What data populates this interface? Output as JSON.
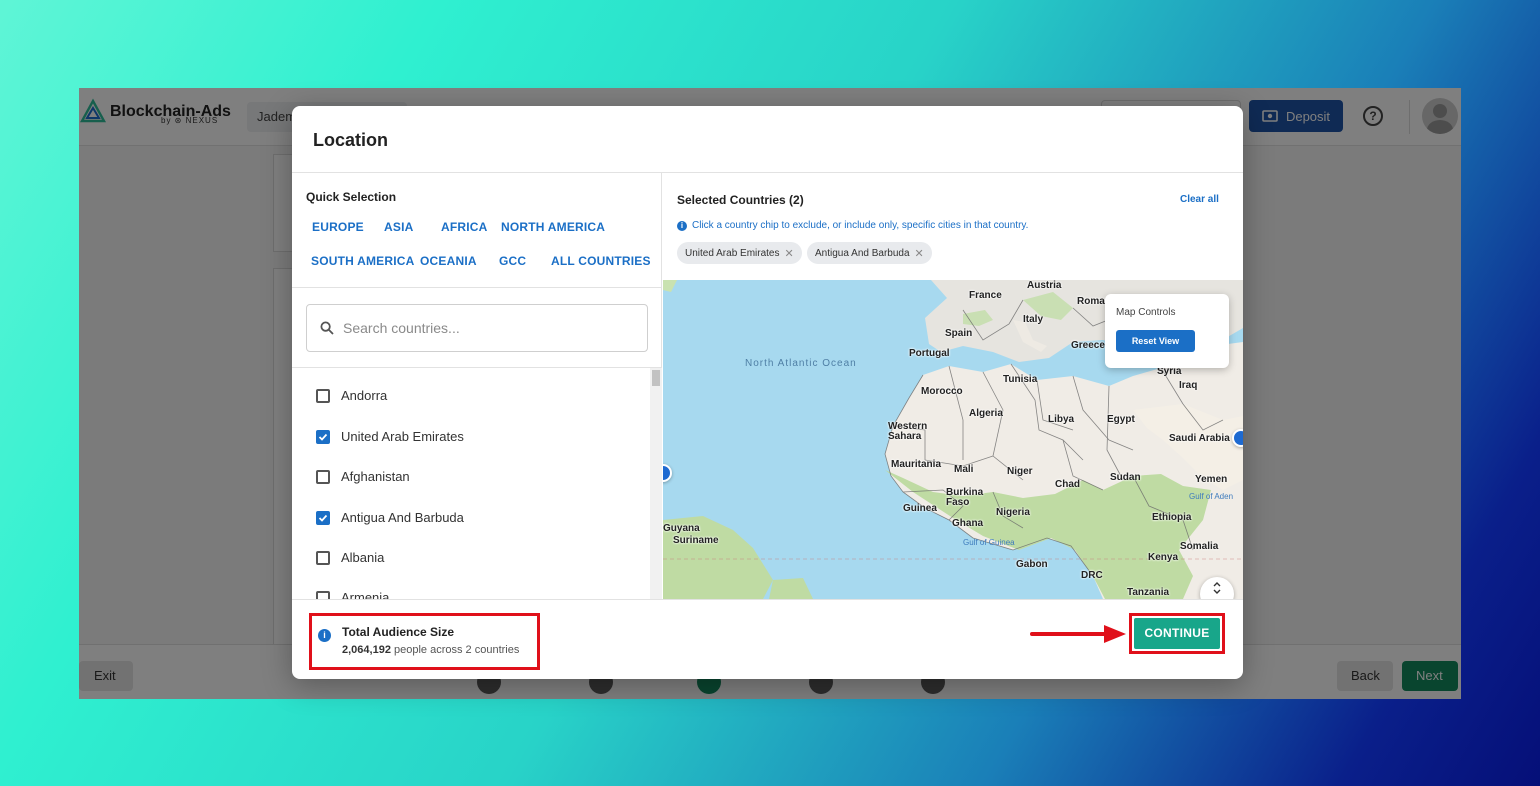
{
  "app": {
    "logo_text": "Blockchain-Ads",
    "logo_sub": "by ⊛ NEXUS",
    "account_name": "Jadem",
    "deposit_label": "Deposit",
    "help_label": "?"
  },
  "footer": {
    "exit_label": "Exit",
    "back_label": "Back",
    "next_label": "Next"
  },
  "modal": {
    "title": "Location",
    "quick_selection_title": "Quick Selection",
    "regions": [
      "EUROPE",
      "ASIA",
      "AFRICA",
      "NORTH AMERICA",
      "SOUTH AMERICA",
      "OCEANIA",
      "GCC",
      "ALL COUNTRIES"
    ],
    "search_placeholder": "Search countries...",
    "countries": [
      {
        "name": "Andorra",
        "checked": false
      },
      {
        "name": "United Arab Emirates",
        "checked": true
      },
      {
        "name": "Afghanistan",
        "checked": false
      },
      {
        "name": "Antigua And Barbuda",
        "checked": true
      },
      {
        "name": "Albania",
        "checked": false
      },
      {
        "name": "Armenia",
        "checked": false
      }
    ],
    "selected_title": "Selected Countries (2)",
    "clear_all_label": "Clear all",
    "hint_text": "Click a country chip to exclude, or include only, specific cities in that country.",
    "chips": [
      "United Arab Emirates",
      "Antigua And Barbuda"
    ],
    "map": {
      "controls_title": "Map Controls",
      "reset_label": "Reset View",
      "ocean_label": "North Atlantic Ocean",
      "labels": [
        "France",
        "Austria",
        "Roma",
        "Italy",
        "Spain",
        "Portugal",
        "Greece",
        "Syria",
        "Iraq",
        "Tunisia",
        "Morocco",
        "Algeria",
        "Libya",
        "Egypt",
        "Western Sahara",
        "Saudi Arabia",
        "Mauritania",
        "Mali",
        "Niger",
        "Chad",
        "Sudan",
        "Yemen",
        "Burkina Faso",
        "Guinea",
        "Ghana",
        "Nigeria",
        "Ethiopia",
        "Somalia",
        "Kenya",
        "Gabon",
        "DRC",
        "Tanzania",
        "Guyana",
        "Suriname"
      ],
      "water_labels": [
        "Gulf of Aden",
        "Gulf of Guinea"
      ]
    },
    "audience_title": "Total Audience Size",
    "audience_count": "2,064,192",
    "audience_suffix": "people across 2 countries",
    "continue_label": "CONTINUE"
  }
}
